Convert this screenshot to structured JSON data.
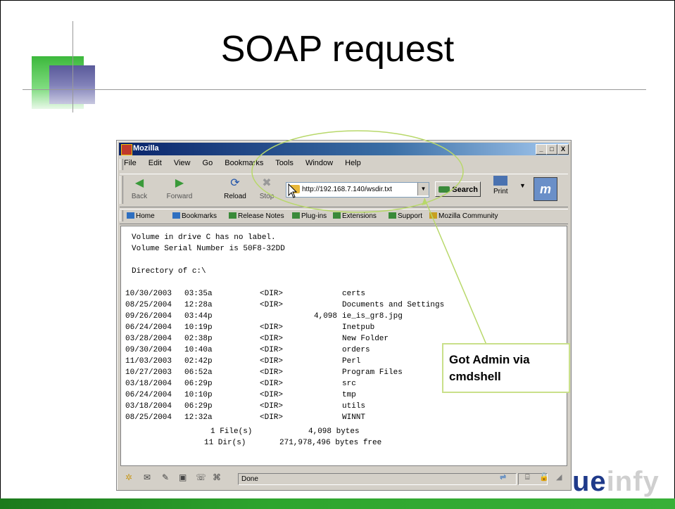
{
  "slide": {
    "title": "SOAP request",
    "brand_part1": "ue",
    "brand_part2": "infy"
  },
  "window": {
    "title": "Mozilla",
    "controls": [
      "_",
      "□",
      "X"
    ]
  },
  "menu": [
    "File",
    "Edit",
    "View",
    "Go",
    "Bookmarks",
    "Tools",
    "Window",
    "Help"
  ],
  "navigation": {
    "back_label": "Back",
    "forward_label": "Forward",
    "reload_label": "Reload",
    "stop_label": "Stop",
    "url": "http://192.168.7.140/wsdir.txt",
    "search_label": "Search",
    "print_label": "Print"
  },
  "personal_toolbar": [
    "Home",
    "Bookmarks",
    "Release Notes",
    "Plug-ins",
    "Extensions",
    "Support",
    "Mozilla Community"
  ],
  "content": {
    "header_lines": [
      "Volume in drive C has no label.",
      "Volume Serial Number is 50F8-32DD",
      "",
      "Directory of c:\\"
    ],
    "entries": [
      {
        "date": "10/30/2003",
        "time": "03:35a",
        "type": "<DIR>",
        "size": "",
        "name": "certs"
      },
      {
        "date": "08/25/2004",
        "time": "12:28a",
        "type": "<DIR>",
        "size": "",
        "name": "Documents and Settings"
      },
      {
        "date": "09/26/2004",
        "time": "03:44p",
        "type": "",
        "size": "4,098",
        "name": "ie_is_gr8.jpg"
      },
      {
        "date": "06/24/2004",
        "time": "10:19p",
        "type": "<DIR>",
        "size": "",
        "name": "Inetpub"
      },
      {
        "date": "03/28/2004",
        "time": "02:38p",
        "type": "<DIR>",
        "size": "",
        "name": "New Folder"
      },
      {
        "date": "09/30/2004",
        "time": "10:40a",
        "type": "<DIR>",
        "size": "",
        "name": "orders"
      },
      {
        "date": "11/03/2003",
        "time": "02:42p",
        "type": "<DIR>",
        "size": "",
        "name": "Perl"
      },
      {
        "date": "10/27/2003",
        "time": "06:52a",
        "type": "<DIR>",
        "size": "",
        "name": "Program Files"
      },
      {
        "date": "03/18/2004",
        "time": "06:29p",
        "type": "<DIR>",
        "size": "",
        "name": "src"
      },
      {
        "date": "06/24/2004",
        "time": "10:10p",
        "type": "<DIR>",
        "size": "",
        "name": "tmp"
      },
      {
        "date": "03/18/2004",
        "time": "06:29p",
        "type": "<DIR>",
        "size": "",
        "name": "utils"
      },
      {
        "date": "08/25/2004",
        "time": "12:32a",
        "type": "<DIR>",
        "size": "",
        "name": "WINNT"
      }
    ],
    "summary": [
      {
        "count": "1 File(s)",
        "value": "4,098 bytes"
      },
      {
        "count": "11 Dir(s)",
        "value": "271,978,496 bytes free"
      }
    ]
  },
  "status": {
    "text": "Done"
  },
  "callout": {
    "line1": "Got Admin via",
    "line2": "cmdshell"
  },
  "colors": {
    "annotation_ellipse": "#b8d86a",
    "titlebar": "#0a246a",
    "brand_blue": "#1f3a8a"
  }
}
